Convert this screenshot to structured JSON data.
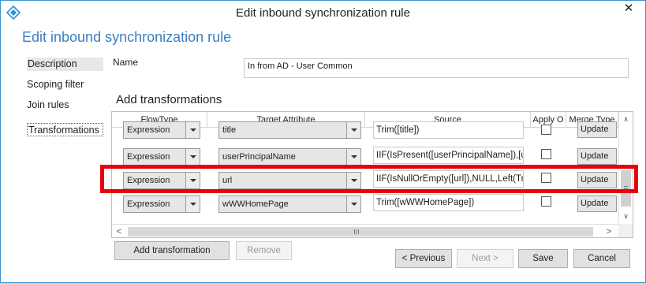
{
  "window": {
    "title": "Edit inbound synchronization rule",
    "close_glyph": "✕"
  },
  "header": {
    "title": "Edit inbound synchronization rule"
  },
  "nav": {
    "items": [
      "Description",
      "Scoping filter",
      "Join rules",
      "Transformations"
    ],
    "selected": "Transformations"
  },
  "name": {
    "label": "Name",
    "value": "In from AD - User Common"
  },
  "transformations": {
    "title": "Add transformations",
    "columns": [
      "FlowType",
      "Target Attribute",
      "Source",
      "Apply O",
      "Merge Type"
    ],
    "rows": [
      {
        "flowtype": "Expression",
        "target": "title",
        "source": "Trim([title])",
        "apply_once": false,
        "merge": "Update"
      },
      {
        "flowtype": "Expression",
        "target": "userPrincipalName",
        "source": "IIF(IsPresent([userPrincipalName]),[u",
        "apply_once": false,
        "merge": "Update"
      },
      {
        "flowtype": "Expression",
        "target": "url",
        "source": "IIF(IsNullOrEmpty([url]),NULL,Left(Tr",
        "apply_once": false,
        "merge": "Update"
      },
      {
        "flowtype": "Expression",
        "target": "wWWHomePage",
        "source": "Trim([wWWHomePage])",
        "apply_once": false,
        "merge": "Update"
      }
    ],
    "highlighted_row": "url",
    "highlight_color": "#e8000b"
  },
  "buttons": {
    "add": "Add transformation",
    "remove": "Remove",
    "previous": "< Previous",
    "next": "Next >",
    "save": "Save",
    "cancel": "Cancel"
  },
  "colors": {
    "accent": "#3b7fc2",
    "window_border": "#3a92d3"
  }
}
